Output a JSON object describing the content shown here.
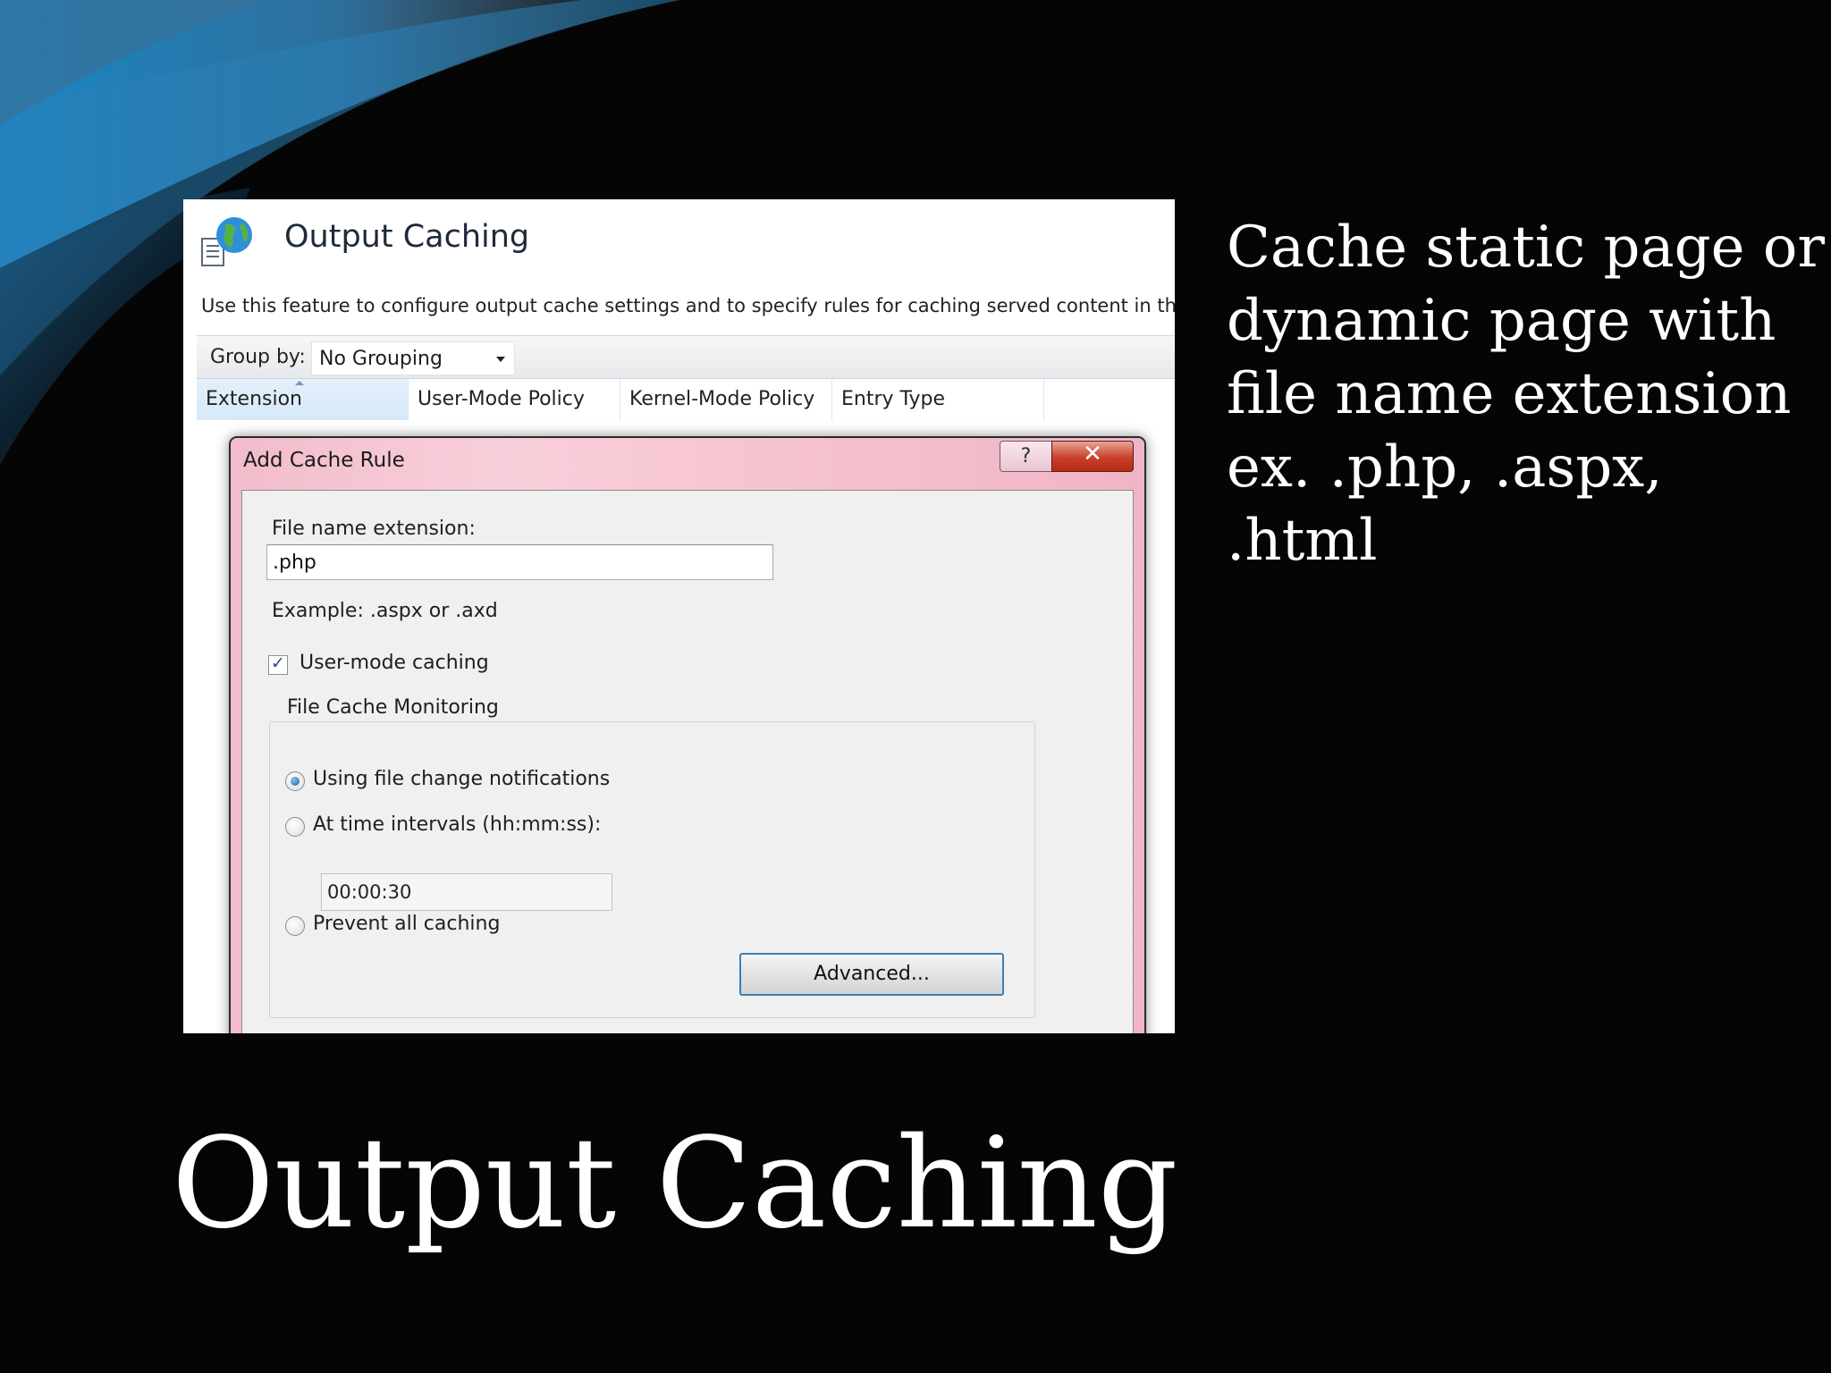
{
  "slide": {
    "title": "Output Caching",
    "side_text_lines": [
      "Cache static page or",
      "dynamic page with",
      "file name extension",
      "ex. .php, .aspx,",
      ".html"
    ]
  },
  "iis_feature": {
    "title": "Output Caching",
    "description": "Use this feature to configure output cache settings and to specify rules for caching served content in the",
    "group_by_label": "Group by:",
    "group_by_value": "No Grouping",
    "columns": [
      "Extension",
      "User-Mode Policy",
      "Kernel-Mode Policy",
      "Entry Type"
    ]
  },
  "dialog": {
    "title": "Add Cache Rule",
    "help_symbol": "?",
    "close_symbol": "✕",
    "file_ext_label": "File name extension:",
    "file_ext_value": ".php",
    "example": "Example: .aspx or .axd",
    "user_mode_caching_label": "User-mode caching",
    "user_mode_caching_checked": true,
    "file_cache_monitoring_label": "File Cache Monitoring",
    "options": [
      {
        "label": "Using file change notifications",
        "selected": true
      },
      {
        "label": "At time intervals (hh:mm:ss):",
        "selected": false
      },
      {
        "label": "Prevent all caching",
        "selected": false
      }
    ],
    "interval_value": "00:00:30",
    "advanced_label": "Advanced..."
  },
  "colors": {
    "slide_background": "#000000",
    "dialog_frame": "#f4c2cf",
    "close_button": "#c8402a",
    "focus_border": "#3c7fb1"
  }
}
